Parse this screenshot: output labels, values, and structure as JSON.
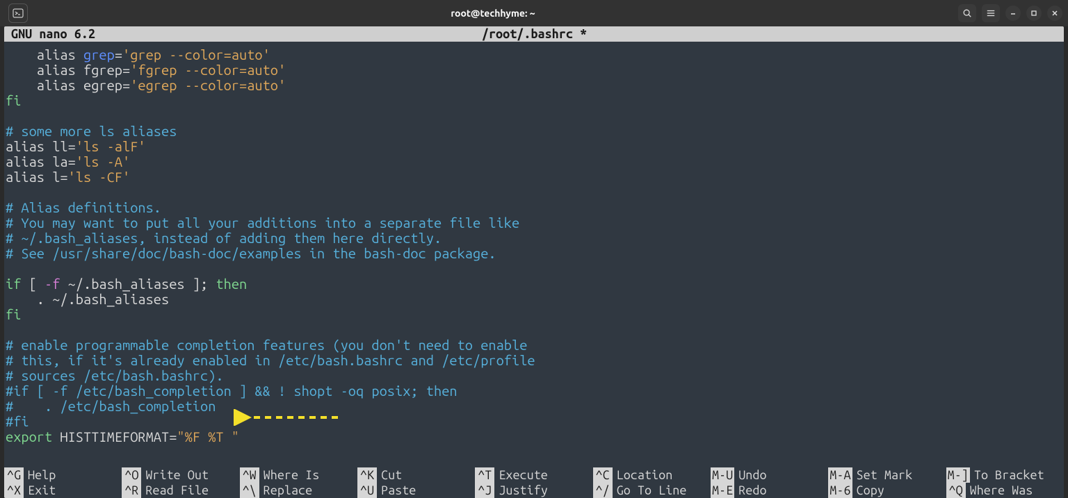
{
  "window": {
    "title": "root@techhyme: ~",
    "icons": {
      "app": "terminal-icon",
      "search": "search-icon",
      "hamburger": "hamburger-icon",
      "min": "minimize-icon",
      "max": "maximize-icon",
      "close": "close-icon"
    }
  },
  "nano": {
    "header_left": "  GNU nano 6.2",
    "header_center": "/root/.bashrc *"
  },
  "code": {
    "l01a": "    alias ",
    "l01b": "grep",
    "l01c": "=",
    "l01d": "'grep --color=auto'",
    "l02a": "    alias fgrep=",
    "l02b": "'fgrep --color=auto'",
    "l03a": "    alias egrep=",
    "l03b": "'egrep --color=auto'",
    "l04": "fi",
    "l06": "# some more ls aliases",
    "l07a": "alias ll=",
    "l07b": "'ls -alF'",
    "l08a": "alias la=",
    "l08b": "'ls -A'",
    "l09a": "alias l=",
    "l09b": "'ls -CF'",
    "l11": "# Alias definitions.",
    "l12": "# You may want to put all your additions into a separate file like",
    "l13": "# ~/.bash_aliases, instead of adding them here directly.",
    "l14": "# See /usr/share/doc/bash-doc/examples in the bash-doc package.",
    "l16a": "if",
    "l16b": " [ ",
    "l16c": "-f",
    "l16d": " ~/.bash_aliases ]; ",
    "l16e": "then",
    "l17": "    . ~/.bash_aliases",
    "l18": "fi",
    "l20": "# enable programmable completion features (you don't need to enable",
    "l21": "# this, if it's already enabled in /etc/bash.bashrc and /etc/profile",
    "l22": "# sources /etc/bash.bashrc).",
    "l23": "#if [ -f /etc/bash_completion ] && ! shopt -oq posix; then",
    "l24": "#    . /etc/bash_completion",
    "l25": "#fi",
    "l26a": "export",
    "l26b": " HISTTIMEFORMAT=",
    "l26c": "\"%F %T \""
  },
  "shortcuts": {
    "row1": [
      {
        "key": "^G",
        "label": "Help"
      },
      {
        "key": "^O",
        "label": "Write Out"
      },
      {
        "key": "^W",
        "label": "Where Is"
      },
      {
        "key": "^K",
        "label": "Cut"
      },
      {
        "key": "^T",
        "label": "Execute"
      },
      {
        "key": "^C",
        "label": "Location"
      },
      {
        "key": "M-U",
        "label": "Undo"
      },
      {
        "key": "M-A",
        "label": "Set Mark"
      },
      {
        "key": "M-]",
        "label": "To Bracket"
      }
    ],
    "row2": [
      {
        "key": "^X",
        "label": "Exit"
      },
      {
        "key": "^R",
        "label": "Read File"
      },
      {
        "key": "^\\",
        "label": "Replace"
      },
      {
        "key": "^U",
        "label": "Paste"
      },
      {
        "key": "^J",
        "label": "Justify"
      },
      {
        "key": "^/",
        "label": "Go To Line"
      },
      {
        "key": "M-E",
        "label": "Redo"
      },
      {
        "key": "M-6",
        "label": "Copy"
      },
      {
        "key": "^Q",
        "label": "Where Was"
      }
    ]
  }
}
